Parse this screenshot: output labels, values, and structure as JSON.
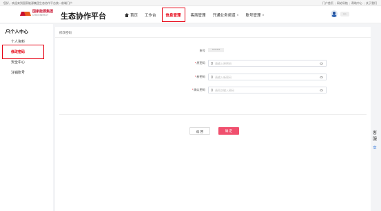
{
  "topbar": {
    "welcome": "您好，欢迎来到国家能源集团生态协作平台统一前端门户",
    "links": [
      "门户首页",
      "网站导航",
      "帮助中心",
      "关于我们"
    ]
  },
  "header": {
    "logo_cn": "国家能源集团",
    "logo_en": "CHN ENERGY",
    "site_title": "生态协作平台",
    "nav": [
      {
        "label": "首页"
      },
      {
        "label": "工作台"
      },
      {
        "label": "信息管理"
      },
      {
        "label": "客商管理"
      },
      {
        "label": "开通业务频道"
      },
      {
        "label": "账号管理"
      }
    ],
    "username": "***"
  },
  "sidebar": {
    "title": "个人中心",
    "items": [
      {
        "label": "个人资料"
      },
      {
        "label": "修改密码"
      },
      {
        "label": "安全中心"
      },
      {
        "label": "注销账号"
      }
    ]
  },
  "main": {
    "breadcrumb": "修改密码",
    "form": {
      "account_label": "账号",
      "account_value": "*******",
      "old_pwd_label": "原密码",
      "old_pwd_placeholder": "请输入原密码",
      "new_pwd_label": "新密码",
      "new_pwd_placeholder": "请输入新密码",
      "confirm_pwd_label": "确认密码",
      "confirm_pwd_placeholder": "请再次输入密码"
    },
    "buttons": {
      "cancel": "返 回",
      "confirm": "确 定"
    }
  },
  "float_tools": {
    "tool1": "客服",
    "tool2": "✲"
  },
  "colors": {
    "accent": "#e60012",
    "confirm_button": "#f0506e",
    "avatar": "#2d63b3"
  }
}
